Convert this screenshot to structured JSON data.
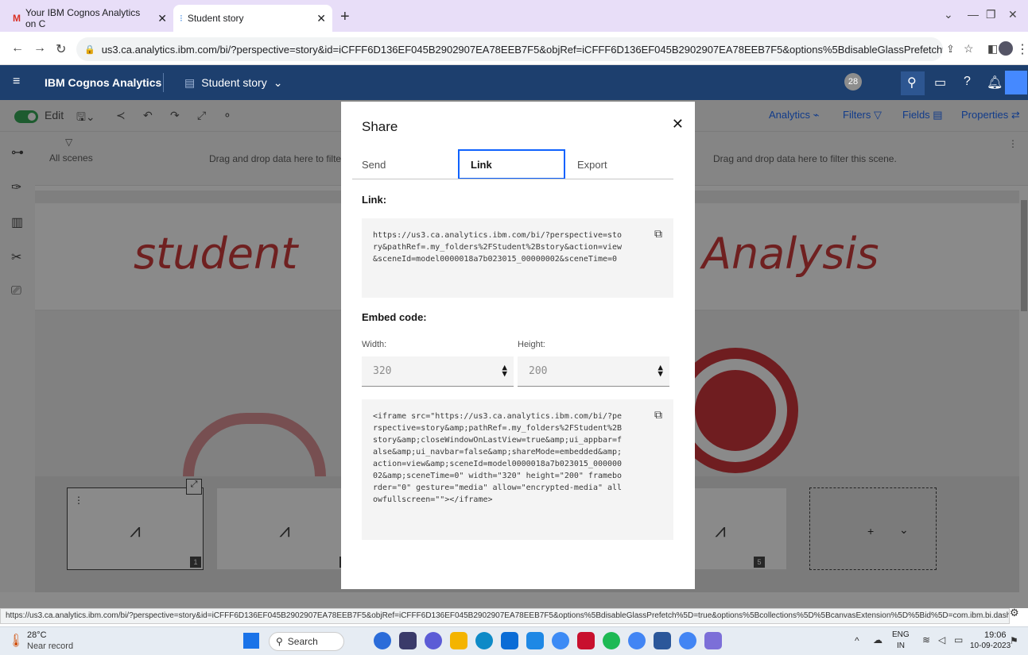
{
  "browser": {
    "tabs": [
      {
        "label": "Your IBM Cognos Analytics on C",
        "active": false
      },
      {
        "label": "Student story",
        "active": true
      }
    ],
    "url": "us3.ca.analytics.ibm.com/bi/?perspective=story&id=iCFFF6D136EF045B2902907EA78EEB7F5&objRef=iCFFF6D136EF045B2902907EA78EEB7F5&options%5BdisableGlassPrefetch%5D=true&options..."
  },
  "app": {
    "title": "IBM Cognos Analytics",
    "story_name": "Student story",
    "notification_count": "28"
  },
  "toolbar": {
    "edit_label": "Edit",
    "analytics": "Analytics",
    "filters": "Filters",
    "fields": "Fields",
    "properties": "Properties"
  },
  "filters": {
    "all_scenes": "All scenes",
    "drop_hint_left": "Drag and drop data here to filte",
    "drop_hint_right": "Drag and drop data here to filter this scene."
  },
  "canvas": {
    "title_left": "student",
    "title_right": "Analysis"
  },
  "timeline": {
    "scene_numbers": [
      "1",
      "2",
      "5"
    ],
    "add_label": "+"
  },
  "modal": {
    "title": "Share",
    "tabs": [
      "Send",
      "Link",
      "Export"
    ],
    "link_label": "Link:",
    "link_text": "https://us3.ca.analytics.ibm.com/bi/?perspective=sto\nry&pathRef=.my_folders%2FStudent%2Bstory&action=view\n&sceneId=model0000018a7b023015_00000002&sceneTime=0",
    "embed_label": "Embed code:",
    "width_label": "Width:",
    "height_label": "Height:",
    "width_value": "320",
    "height_value": "200",
    "embed_text": "<iframe src=\"https://us3.ca.analytics.ibm.com/bi/?pe\nrspective=story&amp;pathRef=.my_folders%2FStudent%2B\nstory&amp;closeWindowOnLastView=true&amp;ui_appbar=f\nalse&amp;ui_navbar=false&amp;shareMode=embedded&amp;\naction=view&amp;sceneId=model0000018a7b023015_000000\n02&amp;sceneTime=0\" width=\"320\" height=\"200\" framebo\nrder=\"0\" gesture=\"media\" allow=\"encrypted-media\" all\nowfullscreen=\"\"></iframe>"
  },
  "status_url": "https://us3.ca.analytics.ibm.com/bi/?perspective=story&id=iCFFF6D136EF045B2902907EA78EEB7F5&objRef=iCFFF6D136EF045B2902907EA78EEB7F5&options%5BdisableGlassPrefetch%5D=true&options%5Bcollections%5D%5BcanvasExtension%5D%5Bid%5D=com.ibm.bi.dashboar...",
  "taskbar": {
    "weather_temp": "28°C",
    "weather_desc": "Near record",
    "search_label": "Search",
    "lang": "ENG",
    "region": "IN",
    "time": "19:06",
    "date": "10-09-2023"
  },
  "colors": {
    "appbar": "#1d3f6e",
    "accent": "#0f62fe",
    "title_red": "#c82a2a"
  }
}
